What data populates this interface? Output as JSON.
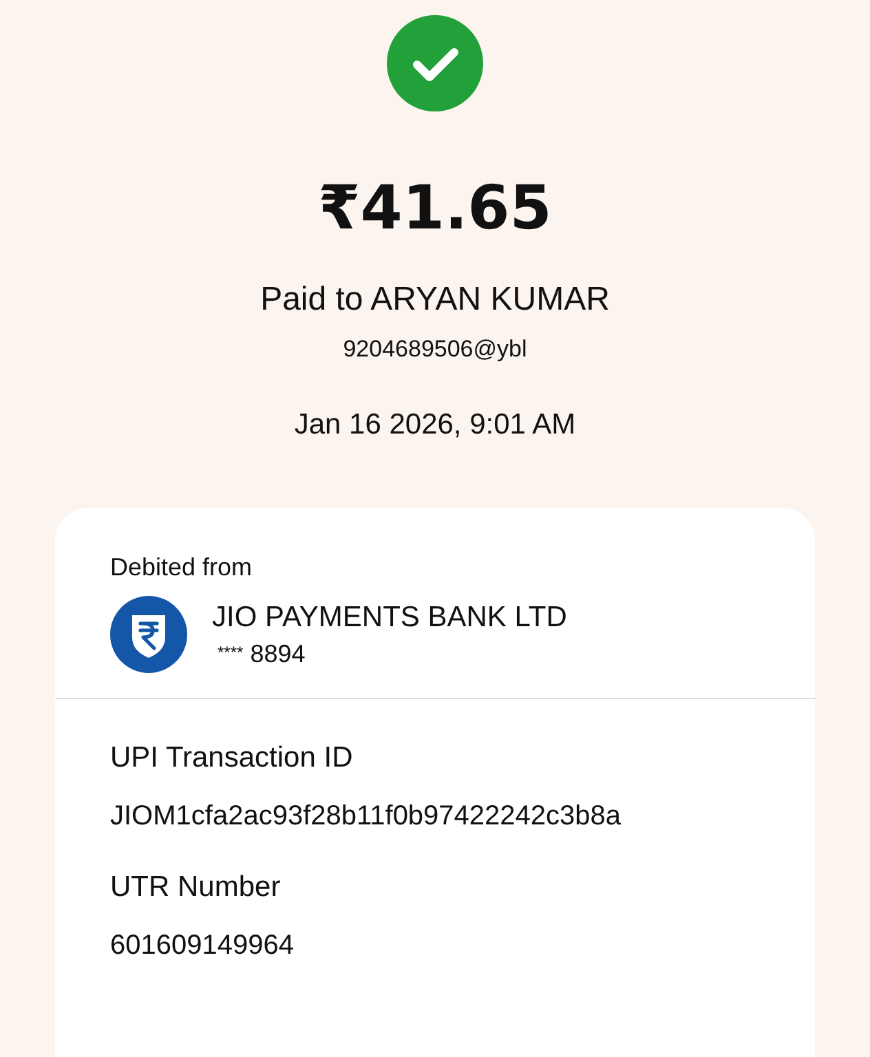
{
  "succeeded": true,
  "amount": "₹41.65",
  "paid_to": "Paid to ARYAN KUMAR",
  "upi_id": "9204689506@ybl",
  "datetime": "Jan 16 2026, 9:01 AM",
  "details": {
    "debited_label": "Debited from",
    "bank": {
      "name": "JIO PAYMENTS BANK LTD",
      "mask": "****",
      "last_digits": "8894"
    },
    "fields": [
      {
        "label": "UPI Transaction ID",
        "value": "JIOM1cfa2ac93f28b11f0b97422242c3b8a"
      },
      {
        "label": "UTR Number",
        "value": "601609149964"
      }
    ]
  }
}
